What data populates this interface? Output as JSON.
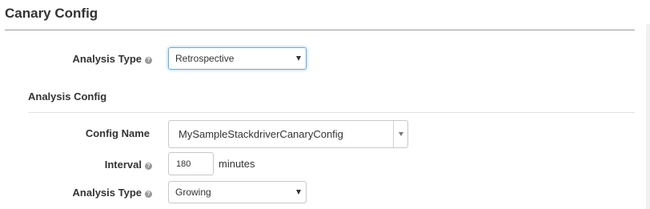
{
  "section": {
    "title": "Canary Config"
  },
  "analysis_type_top": {
    "label": "Analysis Type",
    "value": "Retrospective"
  },
  "analysis_config": {
    "title": "Analysis Config",
    "config_name": {
      "label": "Config Name",
      "value": "MySampleStackdriverCanaryConfig"
    },
    "interval": {
      "label": "Interval",
      "value": "180",
      "unit": "minutes"
    },
    "analysis_type": {
      "label": "Analysis Type",
      "value": "Growing"
    }
  },
  "icons": {
    "help": "question-circle-icon",
    "select_caret": "caret-down-icon"
  },
  "colors": {
    "focus_border": "#66afe9",
    "input_border": "#c8c8c8",
    "rule": "#9a9a9a"
  }
}
